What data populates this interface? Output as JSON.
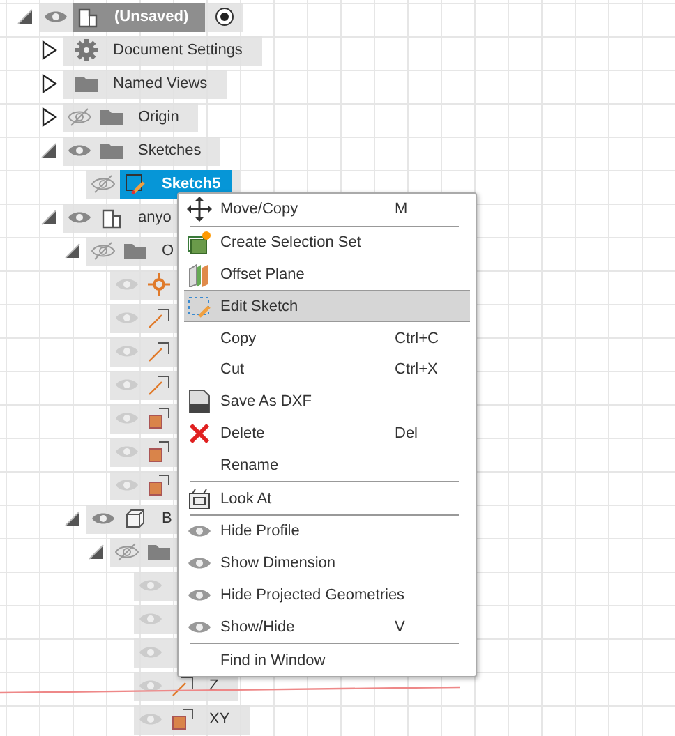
{
  "tree": [
    {
      "kind": "component",
      "label": "(Unsaved)",
      "expanded": true,
      "visible": true,
      "active": true,
      "selected": false,
      "children": [
        {
          "kind": "settings",
          "label": "Document Settings",
          "expanded": false,
          "selected": false
        },
        {
          "kind": "folder",
          "label": "Named Views",
          "expanded": false,
          "selected": false
        },
        {
          "kind": "folder",
          "label": "Origin",
          "expanded": false,
          "visible": false,
          "selected": false
        },
        {
          "kind": "folder",
          "label": "Sketches",
          "expanded": true,
          "visible": true,
          "selected": false,
          "children": [
            {
              "kind": "sketch",
              "label": "Sketch5",
              "visible": false,
              "selected": true
            }
          ]
        },
        {
          "kind": "component",
          "label": "anyo",
          "expanded": true,
          "visible": true,
          "selected": false,
          "children": [
            {
              "kind": "folder",
              "label": "O",
              "expanded": true,
              "visible": false,
              "selected": false,
              "children": [
                {
                  "kind": "point",
                  "visible": true,
                  "selected": false
                },
                {
                  "kind": "axis",
                  "visible": true,
                  "selected": false
                },
                {
                  "kind": "axis",
                  "visible": true,
                  "selected": false
                },
                {
                  "kind": "axis",
                  "visible": true,
                  "selected": false
                },
                {
                  "kind": "plane",
                  "visible": true,
                  "selected": false
                },
                {
                  "kind": "plane",
                  "visible": true,
                  "selected": false
                },
                {
                  "kind": "plane",
                  "visible": true,
                  "selected": false
                }
              ]
            },
            {
              "kind": "body",
              "label": "B",
              "expanded": true,
              "visible": true,
              "selected": false,
              "children": [
                {
                  "kind": "folder",
                  "expanded": true,
                  "visible": false,
                  "selected": false,
                  "children": [
                    {
                      "kind": "none",
                      "visible": true
                    },
                    {
                      "kind": "none",
                      "visible": true
                    },
                    {
                      "kind": "none",
                      "visible": true
                    },
                    {
                      "kind": "axis",
                      "label": "Z",
                      "visible": true,
                      "selected": false
                    },
                    {
                      "kind": "plane",
                      "label": "XY",
                      "visible": true,
                      "selected": false
                    }
                  ]
                }
              ]
            }
          ]
        }
      ]
    }
  ],
  "menu": [
    {
      "kind": "move",
      "label": "Move/Copy",
      "shortcut": "M",
      "separator_after": true,
      "highlighted": false
    },
    {
      "kind": "selection-set",
      "label": "Create Selection Set",
      "highlighted": false
    },
    {
      "kind": "offset-plane",
      "label": "Offset Plane",
      "highlighted": false
    },
    {
      "kind": "edit-sketch",
      "label": "Edit Sketch",
      "highlighted": true
    },
    {
      "kind": "plain",
      "label": "Copy",
      "shortcut": "Ctrl+C",
      "highlighted": false
    },
    {
      "kind": "plain",
      "label": "Cut",
      "shortcut": "Ctrl+X",
      "highlighted": false
    },
    {
      "kind": "dxf",
      "label": "Save As DXF",
      "highlighted": false
    },
    {
      "kind": "delete",
      "label": "Delete",
      "shortcut": "Del",
      "highlighted": false
    },
    {
      "kind": "plain",
      "label": "Rename",
      "separator_after": true,
      "highlighted": false
    },
    {
      "kind": "look-at",
      "label": "Look At",
      "separator_after": true,
      "highlighted": false
    },
    {
      "kind": "eye",
      "label": "Hide Profile",
      "highlighted": false
    },
    {
      "kind": "eye",
      "label": "Show Dimension",
      "highlighted": false
    },
    {
      "kind": "eye",
      "label": "Hide Projected Geometries",
      "highlighted": false
    },
    {
      "kind": "eye",
      "label": "Show/Hide",
      "shortcut": "V",
      "separator_after": true,
      "highlighted": false
    },
    {
      "kind": "plain",
      "label": "Find in Window",
      "highlighted": false
    }
  ]
}
